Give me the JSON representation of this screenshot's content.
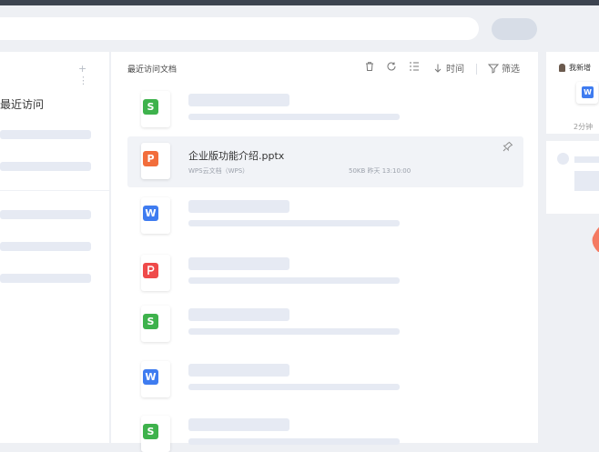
{
  "search": {},
  "sidebar": {
    "head_icons": "+ ⋮",
    "recent_label": "最近访问"
  },
  "main": {
    "title": "最近访问文档",
    "toolbar": {
      "time_label": "时间",
      "filter_label": "筛选"
    },
    "files": [
      {
        "type": "S",
        "color": "#3eb24c"
      },
      {
        "type": "P",
        "color": "#f26d3b",
        "name": "企业版功能介绍.pptx",
        "source": "WPS云文档（WPS）",
        "size_time": "50KB   昨天 13:10:00"
      },
      {
        "type": "W",
        "color": "#3f7cf0"
      },
      {
        "type": "PDF",
        "color": "#ef4a4a"
      },
      {
        "type": "S",
        "color": "#3eb24c"
      },
      {
        "type": "W",
        "color": "#3f7cf0"
      },
      {
        "type": "S",
        "color": "#3eb24c"
      }
    ]
  },
  "right_panel": {
    "owner_label": "我新增",
    "ago_label": "2分钟"
  },
  "colors": {
    "topbar": "#3d4450",
    "background": "#eef0f4",
    "placeholder": "#e6eaf3",
    "highlight": "#f1f3f7",
    "deco": "#f47a62"
  }
}
